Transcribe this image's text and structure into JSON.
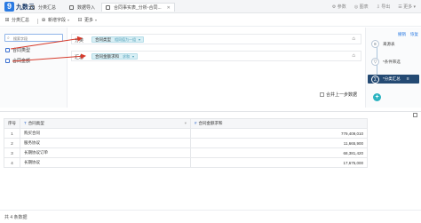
{
  "app": {
    "logo_text": "九数云"
  },
  "header": {
    "tabs": [
      {
        "label": "分类汇总"
      },
      {
        "label": "数据导入"
      },
      {
        "label": "合同事实表_分析-合同..."
      }
    ],
    "right": [
      "参数",
      "图表",
      "导出",
      "更多"
    ]
  },
  "toolbar": {
    "left_dropdown": "分类汇总",
    "add_field": "新增字段",
    "more": "更多"
  },
  "field_panel": {
    "search_placeholder": "搜索字段",
    "fields": [
      "合同类型",
      "合同金额"
    ]
  },
  "config": {
    "group_label": "分类",
    "group_chip": {
      "label": "合同类型",
      "tag": "相同值为一组"
    },
    "summary_label": "汇总",
    "summary_chip": {
      "label": "合同金额求和",
      "tag": "求和"
    },
    "merge_label": "合并上一步数据"
  },
  "step_panel": {
    "links": [
      "撤销",
      "恢复"
    ],
    "steps": [
      {
        "label": "来源表"
      },
      {
        "label": "*条件筛选"
      },
      {
        "label": "*分类汇总"
      }
    ]
  },
  "table": {
    "columns": [
      "序号",
      "合同类型",
      "合同金额求和"
    ],
    "rows": [
      {
        "idx": "1",
        "type": "购买合同",
        "amount": "779,409,010"
      },
      {
        "idx": "2",
        "type": "服务协议",
        "amount": "11,665,900"
      },
      {
        "idx": "3",
        "type": "长期协议订单",
        "amount": "68,381,420"
      },
      {
        "idx": "4",
        "type": "长期协议",
        "amount": "17,675,000"
      }
    ]
  },
  "footer": {
    "row_count": "共 4 条数据"
  },
  "colors": {
    "accent": "#2a7ae2",
    "step_active": "#244a73",
    "chip": "#d8eff5",
    "add_button": "#2bb3c0",
    "annotation": "#d63a2b"
  }
}
